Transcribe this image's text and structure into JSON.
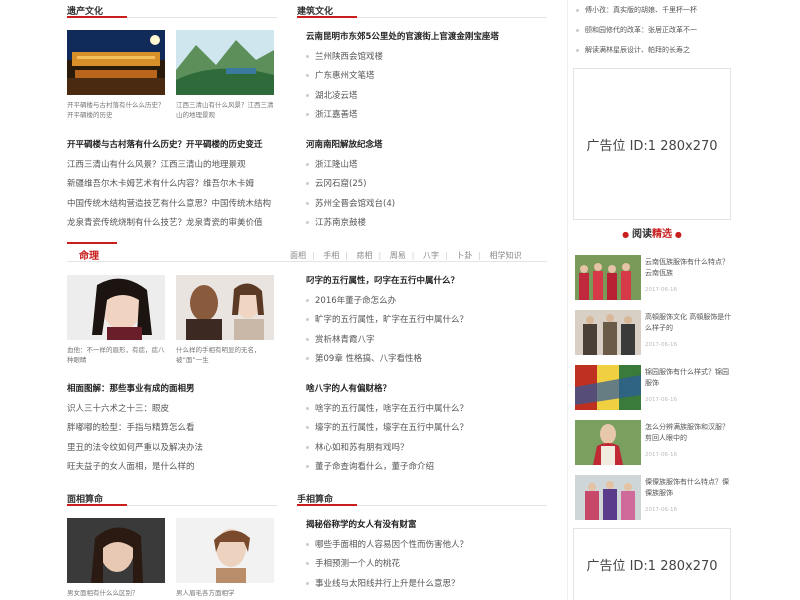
{
  "sections": {
    "heritage": {
      "title": "遗产文化",
      "captions": [
        "开平碉楼与古村落有什么么历史？开平碉楼的历史",
        "江西三清山有什么风景？江西三清山的地理景观"
      ],
      "list": [
        "开平碉楼与古村落有什么历史？开平碉楼的历史变迁",
        "江西三清山有什么风景？江西三清山的地理景观",
        "新疆维吾尔木卡姆艺术有什么内容？维吾尔木卡姆",
        "中国传统木结构营造技艺有什么意思？中国传统木结构",
        "龙泉青瓷传统烧制有什么技艺？龙泉青瓷的审美价值"
      ]
    },
    "architecture": {
      "title": "建筑文化",
      "group1": [
        "云南昆明市东郊5公里处的官渡街上官渡金刚宝座塔",
        "兰州陕西会馆戏楼",
        "广东惠州文笔塔",
        "湖北凌云塔",
        "浙江嘉善塔"
      ],
      "group2": [
        "河南南阳解放纪念塔",
        "浙江隆山塔",
        "云冈石窟(25)",
        "苏州全晋会馆戏台(4)",
        "江苏南京鼓楼"
      ]
    },
    "fortune": {
      "title": "命理",
      "tabs": [
        "面相",
        "手相",
        "痣相",
        "周易",
        "八字",
        "卜卦",
        "相学知识"
      ],
      "captions": [
        "血他：不一样的眉形，有痣，痣八种眼睛",
        "什么样的手相有明显的无名，被“面”一生"
      ],
      "list": [
        "相面图解：那些事业有成的面相男",
        "识人三十六术之十三：眼皮",
        "胖嘟嘟的脸型：手指与精算怎么看",
        "里丑的法令纹如何严重以及解决办法",
        "旺夫益子的女人面相，是什么样的"
      ],
      "group1": [
        "叼字的五行属性，叼字在五行中属什么？",
        "2016年董子命怎么办",
        "旷字的五行属性，旷字在五行中属什么？",
        "赏析林青霞八字",
        "第09章 性格搞、八字看性格"
      ],
      "group2": [
        "啥八字的人有偏财格？",
        "啥字的五行属性，啥字在五行中属什么？",
        "壕字的五行属性，壕字在五行中属什么？",
        "林心如和苏有朋有戏吗？",
        "董子命查询看什么，董子命介绍"
      ]
    },
    "face": {
      "title": "面相算命",
      "captions": [
        "男女面相有什么么区别？",
        "男人眉毛各方面相学"
      ]
    },
    "palm": {
      "title": "手相算命",
      "list": [
        "揭秘俗称学的女人有没有财富",
        "哪些手面相的人容易因个性而伤害他人？",
        "手相预测一个人的桃花",
        "事业线与太阳线并行上升是什么意思？"
      ]
    }
  },
  "sidebar": {
    "top_links": [
      "傅小孜：真实版的胡娘、千里杯一杯",
      "颐和园修代的改革：张居正改革不一",
      "解读满林星辰设计、帕拜的长寿之"
    ],
    "ad_label": "广告位 ID:1 280x270",
    "reading_title": "阅读",
    "reading_title_red": "精选",
    "items": [
      {
        "text": "云南佤族服饰有什么特点？云南佤族",
        "date": "2017-06-16"
      },
      {
        "text": "高頓服饰文化 高頓服饰是什么样子的",
        "date": "2017-06-16"
      },
      {
        "text": "锦园服饰有什么样式？锦园服饰",
        "date": "2017-06-16"
      },
      {
        "text": "怎么分辨满族服饰和汉服？剪回人眼中的",
        "date": "2017-06-16"
      },
      {
        "text": "傈僳族服饰有什么特点？傈傈族服饰",
        "date": "2017-06-16"
      }
    ],
    "ad2_label": "广告位 ID:1 280x270"
  }
}
